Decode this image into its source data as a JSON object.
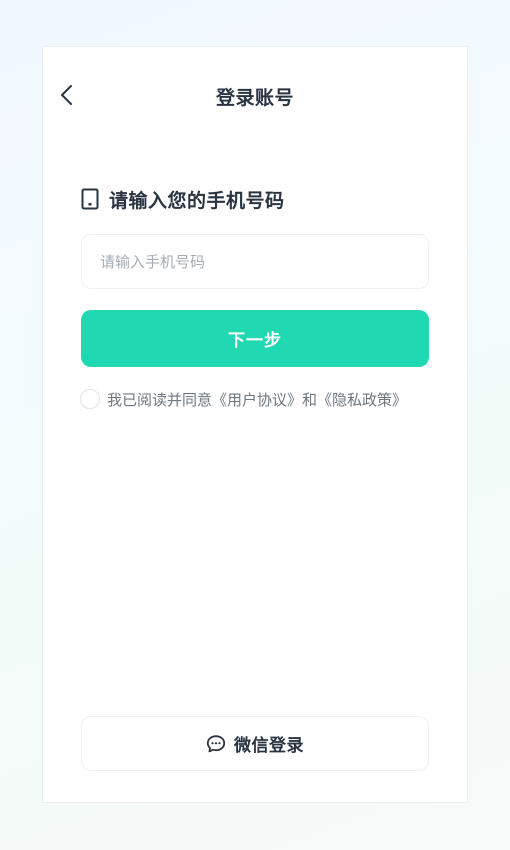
{
  "header": {
    "title": "登录账号",
    "back_icon": "chevron-left-icon"
  },
  "prompt": {
    "icon": "phone-icon",
    "text": "请输入您的手机号码"
  },
  "phone_input": {
    "value": "",
    "placeholder": "请输入手机号码"
  },
  "next_button": {
    "label": "下一步"
  },
  "agreement": {
    "checked": false,
    "prefix": "我已阅读并同意",
    "user_agreement": "《用户协议》",
    "conjunction": "和",
    "privacy_policy": "《隐私政策》"
  },
  "wechat_login": {
    "icon": "chat-bubble-icon",
    "label": "微信登录"
  },
  "colors": {
    "primary": "#20d9b3",
    "text_dark": "#2a3441",
    "text_muted": "#6d7782",
    "placeholder": "#a6acb3"
  }
}
